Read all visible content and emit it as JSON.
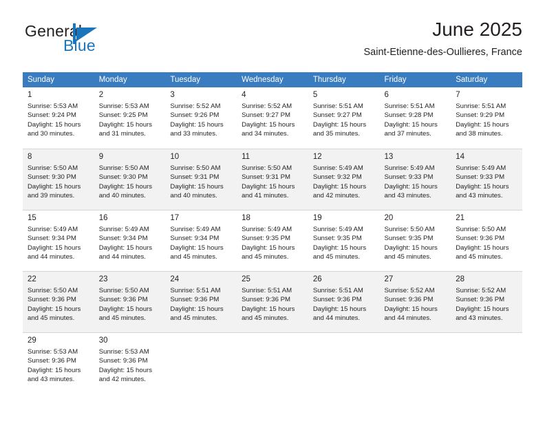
{
  "brand": {
    "name_part1": "General",
    "name_part2": "Blue",
    "mark_icon": "triangle-flag-icon",
    "accent_color": "#1b75bb"
  },
  "header": {
    "title": "June 2025",
    "subtitle": "Saint-Etienne-des-Oullieres, France"
  },
  "calendar": {
    "header_color": "#3a7cc0",
    "weekday_headers": [
      "Sunday",
      "Monday",
      "Tuesday",
      "Wednesday",
      "Thursday",
      "Friday",
      "Saturday"
    ],
    "weeks": [
      [
        {
          "day": "1",
          "info": "Sunrise: 5:53 AM\nSunset: 9:24 PM\nDaylight: 15 hours\nand 30 minutes."
        },
        {
          "day": "2",
          "info": "Sunrise: 5:53 AM\nSunset: 9:25 PM\nDaylight: 15 hours\nand 31 minutes."
        },
        {
          "day": "3",
          "info": "Sunrise: 5:52 AM\nSunset: 9:26 PM\nDaylight: 15 hours\nand 33 minutes."
        },
        {
          "day": "4",
          "info": "Sunrise: 5:52 AM\nSunset: 9:27 PM\nDaylight: 15 hours\nand 34 minutes."
        },
        {
          "day": "5",
          "info": "Sunrise: 5:51 AM\nSunset: 9:27 PM\nDaylight: 15 hours\nand 35 minutes."
        },
        {
          "day": "6",
          "info": "Sunrise: 5:51 AM\nSunset: 9:28 PM\nDaylight: 15 hours\nand 37 minutes."
        },
        {
          "day": "7",
          "info": "Sunrise: 5:51 AM\nSunset: 9:29 PM\nDaylight: 15 hours\nand 38 minutes."
        }
      ],
      [
        {
          "day": "8",
          "info": "Sunrise: 5:50 AM\nSunset: 9:30 PM\nDaylight: 15 hours\nand 39 minutes."
        },
        {
          "day": "9",
          "info": "Sunrise: 5:50 AM\nSunset: 9:30 PM\nDaylight: 15 hours\nand 40 minutes."
        },
        {
          "day": "10",
          "info": "Sunrise: 5:50 AM\nSunset: 9:31 PM\nDaylight: 15 hours\nand 40 minutes."
        },
        {
          "day": "11",
          "info": "Sunrise: 5:50 AM\nSunset: 9:31 PM\nDaylight: 15 hours\nand 41 minutes."
        },
        {
          "day": "12",
          "info": "Sunrise: 5:49 AM\nSunset: 9:32 PM\nDaylight: 15 hours\nand 42 minutes."
        },
        {
          "day": "13",
          "info": "Sunrise: 5:49 AM\nSunset: 9:33 PM\nDaylight: 15 hours\nand 43 minutes."
        },
        {
          "day": "14",
          "info": "Sunrise: 5:49 AM\nSunset: 9:33 PM\nDaylight: 15 hours\nand 43 minutes."
        }
      ],
      [
        {
          "day": "15",
          "info": "Sunrise: 5:49 AM\nSunset: 9:34 PM\nDaylight: 15 hours\nand 44 minutes."
        },
        {
          "day": "16",
          "info": "Sunrise: 5:49 AM\nSunset: 9:34 PM\nDaylight: 15 hours\nand 44 minutes."
        },
        {
          "day": "17",
          "info": "Sunrise: 5:49 AM\nSunset: 9:34 PM\nDaylight: 15 hours\nand 45 minutes."
        },
        {
          "day": "18",
          "info": "Sunrise: 5:49 AM\nSunset: 9:35 PM\nDaylight: 15 hours\nand 45 minutes."
        },
        {
          "day": "19",
          "info": "Sunrise: 5:49 AM\nSunset: 9:35 PM\nDaylight: 15 hours\nand 45 minutes."
        },
        {
          "day": "20",
          "info": "Sunrise: 5:50 AM\nSunset: 9:35 PM\nDaylight: 15 hours\nand 45 minutes."
        },
        {
          "day": "21",
          "info": "Sunrise: 5:50 AM\nSunset: 9:36 PM\nDaylight: 15 hours\nand 45 minutes."
        }
      ],
      [
        {
          "day": "22",
          "info": "Sunrise: 5:50 AM\nSunset: 9:36 PM\nDaylight: 15 hours\nand 45 minutes."
        },
        {
          "day": "23",
          "info": "Sunrise: 5:50 AM\nSunset: 9:36 PM\nDaylight: 15 hours\nand 45 minutes."
        },
        {
          "day": "24",
          "info": "Sunrise: 5:51 AM\nSunset: 9:36 PM\nDaylight: 15 hours\nand 45 minutes."
        },
        {
          "day": "25",
          "info": "Sunrise: 5:51 AM\nSunset: 9:36 PM\nDaylight: 15 hours\nand 45 minutes."
        },
        {
          "day": "26",
          "info": "Sunrise: 5:51 AM\nSunset: 9:36 PM\nDaylight: 15 hours\nand 44 minutes."
        },
        {
          "day": "27",
          "info": "Sunrise: 5:52 AM\nSunset: 9:36 PM\nDaylight: 15 hours\nand 44 minutes."
        },
        {
          "day": "28",
          "info": "Sunrise: 5:52 AM\nSunset: 9:36 PM\nDaylight: 15 hours\nand 43 minutes."
        }
      ],
      [
        {
          "day": "29",
          "info": "Sunrise: 5:53 AM\nSunset: 9:36 PM\nDaylight: 15 hours\nand 43 minutes."
        },
        {
          "day": "30",
          "info": "Sunrise: 5:53 AM\nSunset: 9:36 PM\nDaylight: 15 hours\nand 42 minutes."
        },
        {
          "day": "",
          "info": ""
        },
        {
          "day": "",
          "info": ""
        },
        {
          "day": "",
          "info": ""
        },
        {
          "day": "",
          "info": ""
        },
        {
          "day": "",
          "info": ""
        }
      ]
    ]
  }
}
